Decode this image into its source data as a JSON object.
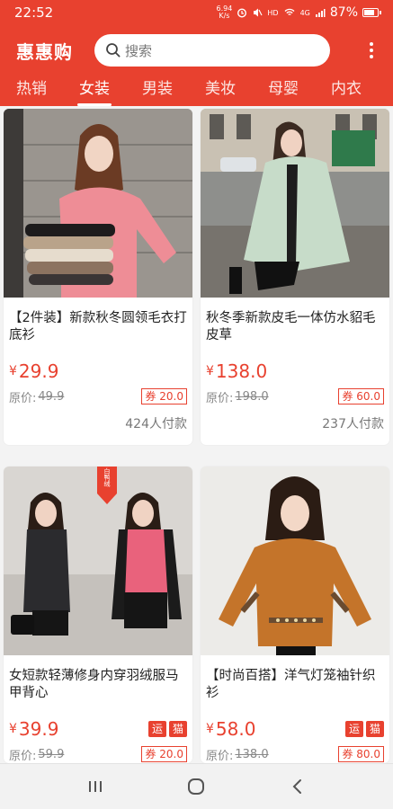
{
  "status_bar": {
    "time": "22:52",
    "net_speed": "6.94 K/s",
    "hd": "HD",
    "signal_type": "4G",
    "battery": "87%",
    "battery_level": 0.87
  },
  "header": {
    "brand": "惠惠购",
    "search_placeholder": "搜索"
  },
  "tabs": [
    {
      "label": "热销",
      "active": false
    },
    {
      "label": "女装",
      "active": true
    },
    {
      "label": "男装",
      "active": false
    },
    {
      "label": "美妆",
      "active": false
    },
    {
      "label": "母婴",
      "active": false
    },
    {
      "label": "内衣",
      "active": false
    }
  ],
  "products": [
    {
      "title": "【2件装】新款秋冬圆领毛衣打底衫",
      "currency": "¥",
      "price": "29.9",
      "orig_label": "原价:",
      "orig_price": "49.9",
      "coupon": "券 20.0",
      "sold": "424人付款",
      "badges": []
    },
    {
      "title": "秋冬季新款皮毛一体仿水貂毛皮草",
      "currency": "¥",
      "price": "138.0",
      "orig_label": "原价:",
      "orig_price": "198.0",
      "coupon": "券 60.0",
      "sold": "237人付款",
      "badges": []
    },
    {
      "title": "女短款轻薄修身内穿羽绒服马甲背心",
      "currency": "¥",
      "price": "39.9",
      "orig_label": "原价:",
      "orig_price": "59.9",
      "coupon": "券 20.0",
      "sold": "",
      "badges": [
        "运",
        "猫"
      ],
      "photo_tag": "白鸭绒"
    },
    {
      "title": "【时尚百搭】洋气灯笼袖针织衫",
      "currency": "¥",
      "price": "58.0",
      "orig_label": "原价:",
      "orig_price": "138.0",
      "coupon": "券 80.0",
      "sold": "",
      "badges": [
        "运",
        "猫"
      ]
    }
  ],
  "colors": {
    "accent": "#e8412f",
    "background": "#f3f3f3"
  }
}
